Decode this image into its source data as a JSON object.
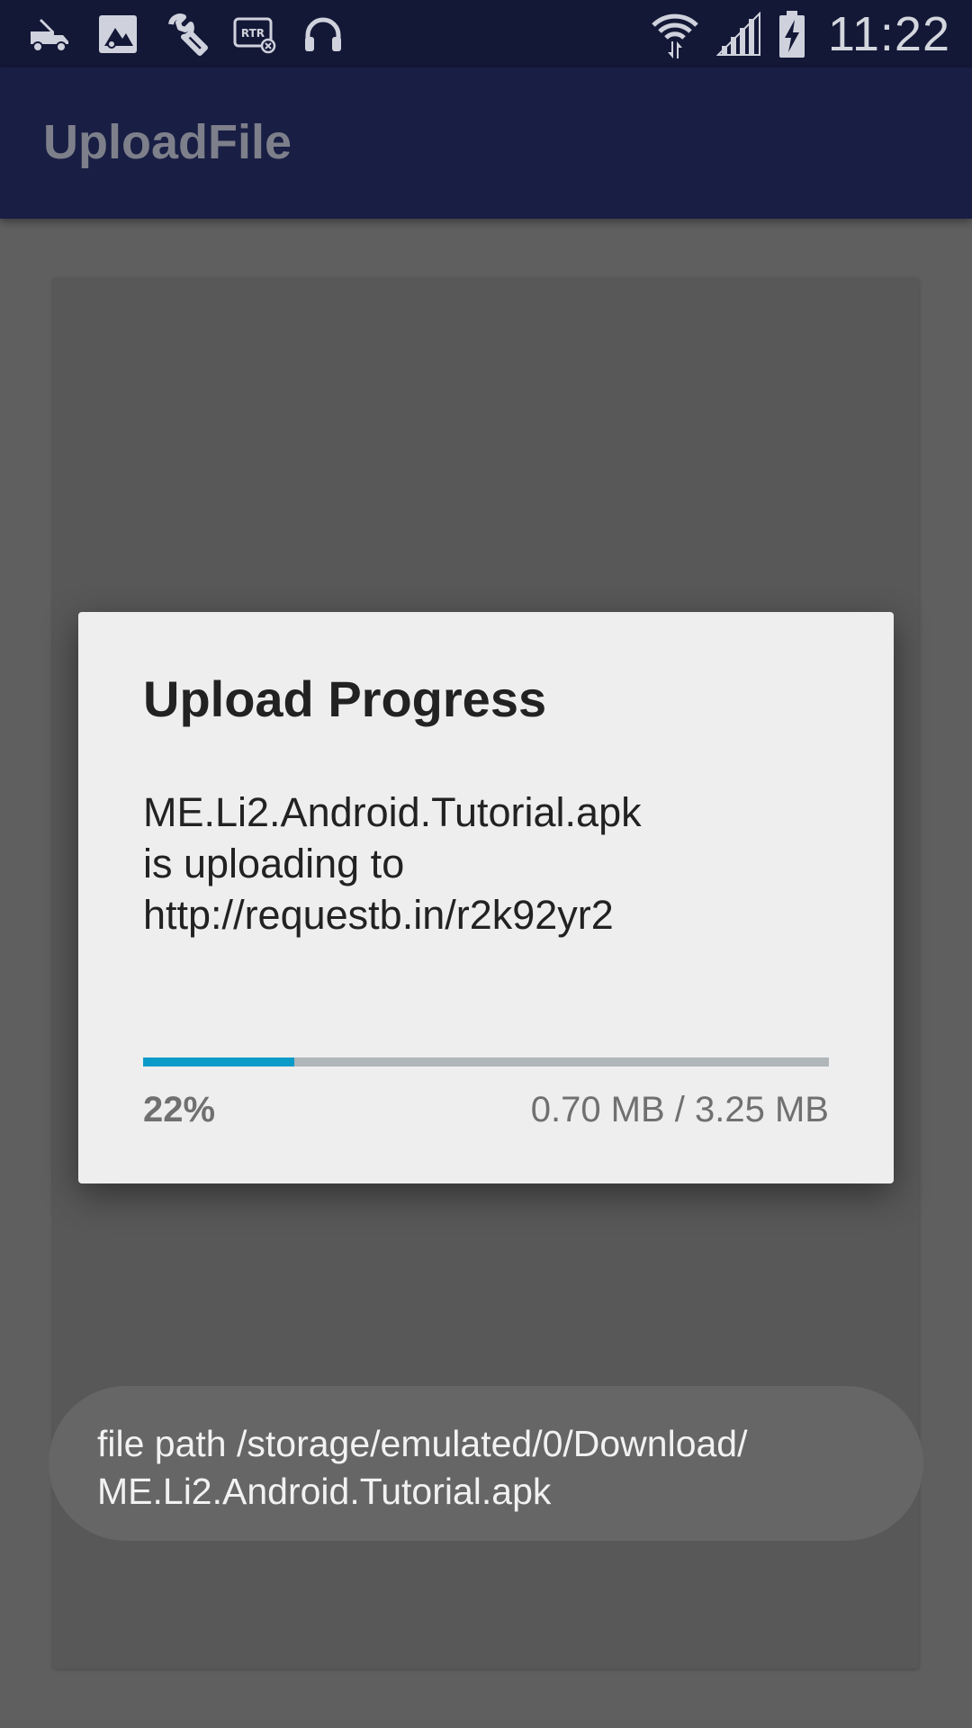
{
  "status_bar": {
    "left_icons": [
      "truck-icon",
      "upload-image-icon",
      "wrench-icon",
      "rtr-icon",
      "headphones-icon"
    ],
    "right_icons": [
      "wifi-icon",
      "signal-icon",
      "battery-charging-icon"
    ],
    "time": "11:22",
    "icon_color": "#cfd2dc",
    "background": "#141837"
  },
  "app_bar": {
    "title": "UploadFile",
    "background": "#191e44"
  },
  "dialog": {
    "title": "Upload Progress",
    "message_lines": [
      "ME.Li2.Android.Tutorial.apk",
      "is uploading to",
      "http://requestb.in/r2k92yr2"
    ],
    "progress": {
      "value": 0.22,
      "percent_label": "22%",
      "size_label": "0.70 MB / 3.25 MB",
      "fill_color": "#0a9bc8",
      "track_color": "#b0b6b9"
    }
  },
  "toast": {
    "lines": [
      "file path /storage/emulated/0/Download/",
      "ME.Li2.Android.Tutorial.apk"
    ]
  }
}
